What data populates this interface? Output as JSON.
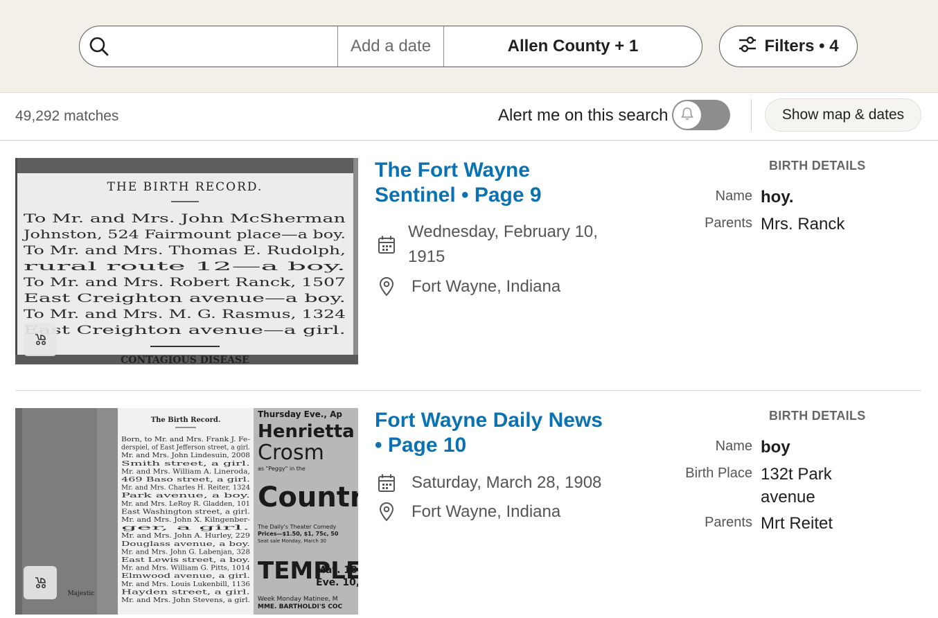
{
  "search": {
    "query_placeholder": "",
    "date_placeholder": "Add a date",
    "location": "Allen County + 1",
    "filters_label": "Filters • 4"
  },
  "results_bar": {
    "match_count": "49,292 matches",
    "alert_label": "Alert me on this search",
    "alert_enabled": false,
    "map_button": "Show map & dates"
  },
  "results": [
    {
      "title": "The Fort Wayne Sentinel • Page 9",
      "date": "Wednesday, February 10, 1915",
      "location": "Fort Wayne, Indiana",
      "details_heading": "BIRTH DETAILS",
      "details": [
        {
          "label": "Name",
          "value": "hoy."
        },
        {
          "label": "Parents",
          "value": "Mrs. Ranck"
        }
      ],
      "clipping": {
        "heading": "THE BIRTH RECORD.",
        "lines": [
          "To Mr. and Mrs. John McSherman",
          "Johnston, 524 Fairmount place—a boy.",
          "To Mr. and Mrs. Thomas E. Rudolph,",
          "rural route 12—a boy.",
          "To Mr. and Mrs. Robert Ranck, 1507",
          "East Creighton avenue—a boy.",
          "To Mr. and Mrs. M. G. Rasmus, 1324",
          "East Creighton avenue—a girl."
        ],
        "footer": "CONTAGIOUS DISEASE"
      }
    },
    {
      "title": "Fort Wayne Daily News • Page 10",
      "date": "Saturday, March 28, 1908",
      "location": "Fort Wayne, Indiana",
      "details_heading": "BIRTH DETAILS",
      "details": [
        {
          "label": "Name",
          "value": "boy"
        },
        {
          "label": "Birth Place",
          "value": "132t Park avenue"
        },
        {
          "label": "Parents",
          "value": "Mrt Reitet"
        }
      ],
      "clipping": {
        "heading": "The Birth Record.",
        "lines": [
          "Born, to Mr. and Mrs. Frank J. Fe-",
          "derspiel, of East Jefferson street, a girl.",
          "Mr. and Mrs. John Lindesuin, 2008",
          "Smith street, a girl.",
          "Mr. and Mrs. William A. Lineroda,",
          "469 Baso street, a girl.",
          "Mr. and Mrs. Charles H. Reiter, 1324",
          "Park avenue, a boy.",
          "Mr. and Mrs. LeRoy R. Gladden, 101",
          "East Washington street, a girl.",
          "Mr. and Mrs. John X. Kilngenber-",
          "ger, a girl.",
          "Mr. and Mrs. John A. Hurley, 229",
          "Douglass avenue, a boy.",
          "Mr. and Mrs. John G. Labenjan, 328",
          "East Lewis street, a boy.",
          "Mr. and Mrs. William G. Pitts, 1014",
          "Elmwood avenue, a girl.",
          "Mr. and Mrs. Louis Lukenbill, 1136",
          "Hayden street, a girl.",
          "Mr. and Mrs. John Stevens, a girl."
        ],
        "side_ad": [
          "Thursday Eve., Ap",
          "Henrietta",
          "Crosm",
          "as \"Peggy\" in the",
          "Country G",
          "The Daily's Theater Comedy",
          "Prices—$1.50, $1, 75c, 50",
          "Seat sale Monday, March 30",
          "TEMPLE",
          "Mat. 10",
          "Eve. 10,",
          "Week Monday Matinee, M",
          "MME. BARTHOLDI'S COC"
        ],
        "left_caption": "Majestic"
      }
    }
  ],
  "icons": {
    "search": "search-icon",
    "filters": "sliders-icon",
    "bell": "bell-icon",
    "calendar": "calendar-icon",
    "location": "map-pin-icon",
    "clip_badge": "baby-stroller-icon"
  },
  "colors": {
    "accent_link": "#0a72b2",
    "header_bg": "#f3efe9",
    "toggle_off": "#8d8d8d"
  }
}
